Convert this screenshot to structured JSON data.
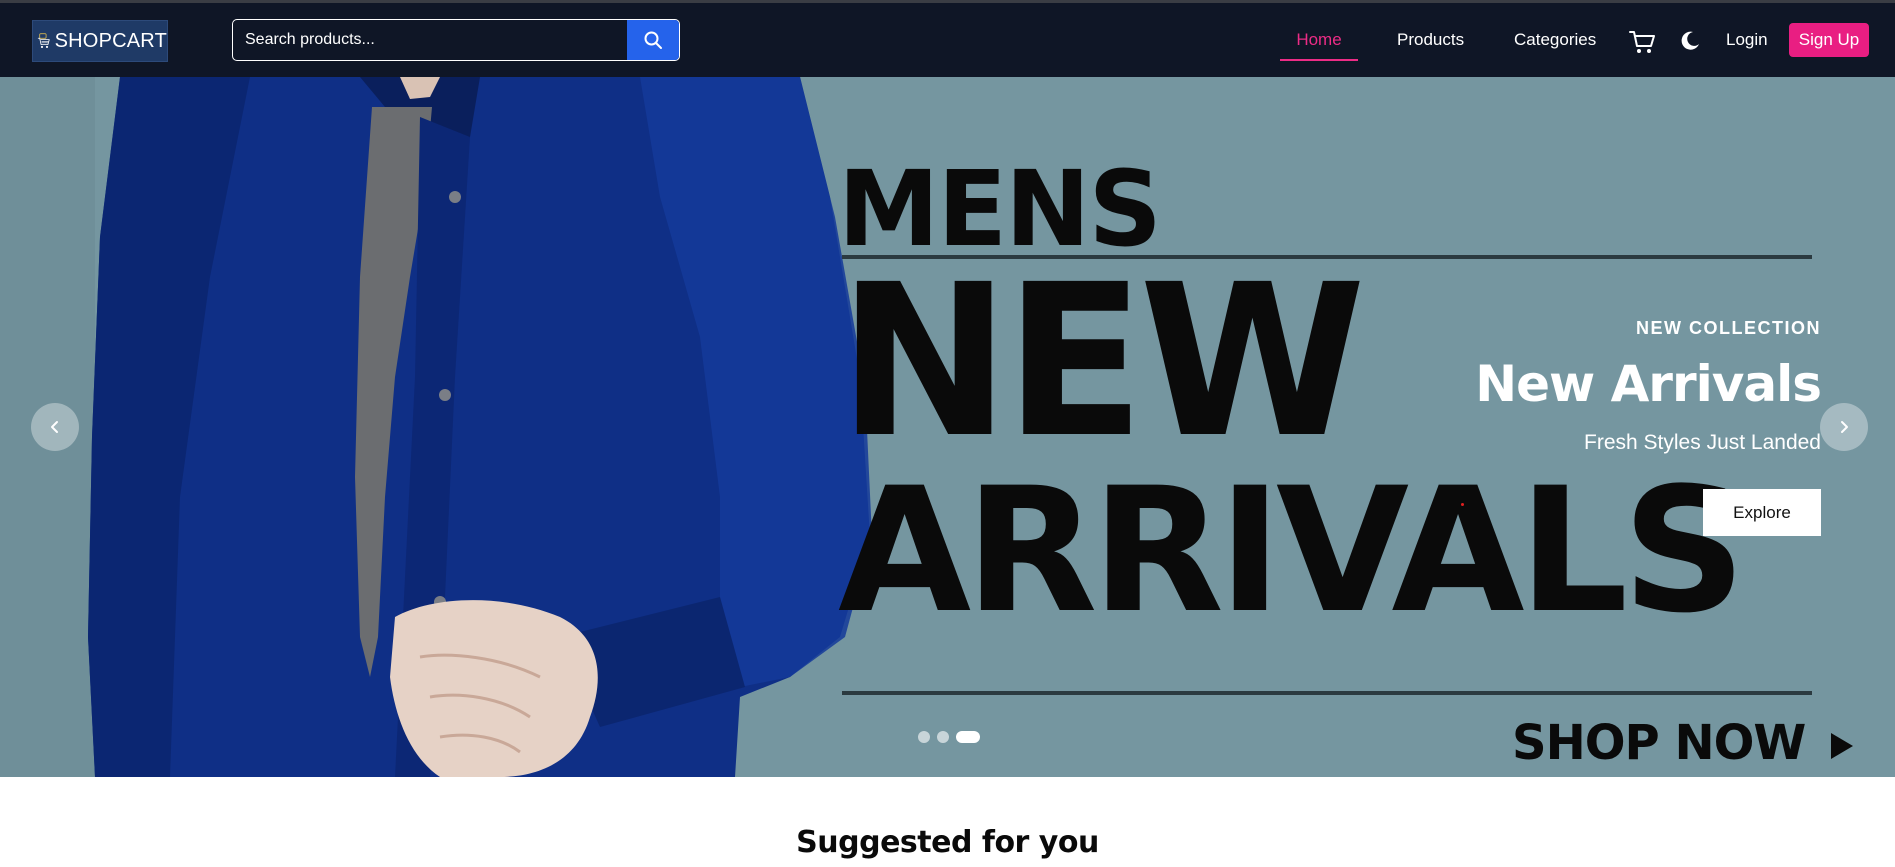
{
  "brand": {
    "name": "SHOPCART"
  },
  "search": {
    "placeholder": "Search products...",
    "icon": "search-icon"
  },
  "nav": {
    "home": "Home",
    "products": "Products",
    "categories": "Categories",
    "login": "Login",
    "signup": "Sign Up",
    "active": "Home"
  },
  "hero": {
    "eyebrow": "NEW COLLECTION",
    "title": "New Arrivals",
    "subtitle": "Fresh Styles Just Landed",
    "cta": "Explore",
    "poster": {
      "line1": "MENS",
      "line2": "NEW",
      "line3": "ARRIVALS",
      "cta": "SHOP NOW"
    },
    "slides": 3,
    "active_slide": 3
  },
  "sections": {
    "suggested_title": "Suggested for you"
  },
  "colors": {
    "navbar": "#0f1626",
    "accent_pink": "#e91e82",
    "search_button": "#2563eb",
    "hero_bg": "#7596a0",
    "jacket": "#0f2f86"
  }
}
